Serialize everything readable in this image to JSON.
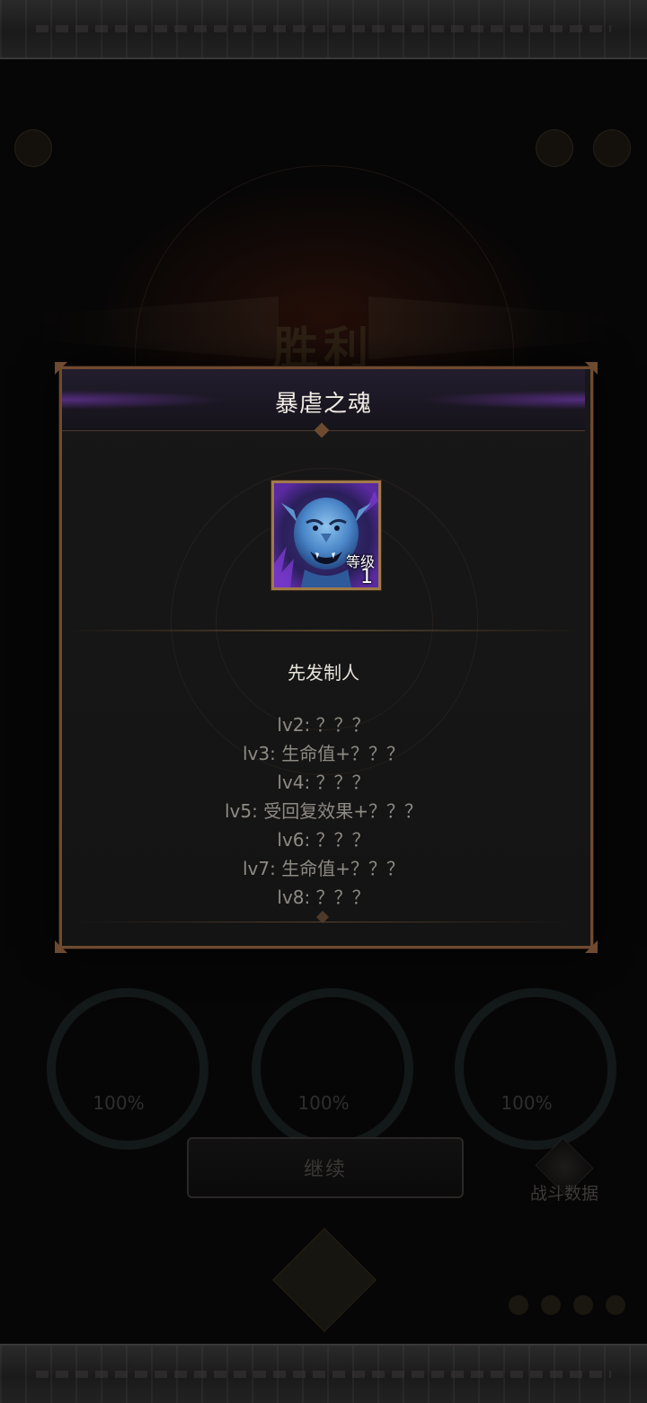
{
  "background": {
    "title": "胜利",
    "slots": [
      {
        "percent": "100%"
      },
      {
        "percent": "100%"
      },
      {
        "percent": "100%"
      }
    ],
    "continue_label": "继续",
    "stats_label": "战斗数据"
  },
  "dialog": {
    "title": "暴虐之魂",
    "item": {
      "icon": "troll-head-icon",
      "level_label": "等级",
      "level_value": "1"
    },
    "skill_name": "先发制人",
    "levels": [
      "lv2: ？？？",
      "lv3: 生命值+？？？",
      "lv4: ？？？",
      "lv5: 受回复效果+？？？",
      "lv6: ？？？",
      "lv7: 生命值+？？？",
      "lv8: ？？？"
    ]
  },
  "colors": {
    "frame": "#6e4a30",
    "header_purple": "#823cc8",
    "text_primary": "#f1ece4",
    "text_muted": "#8e8a84"
  }
}
